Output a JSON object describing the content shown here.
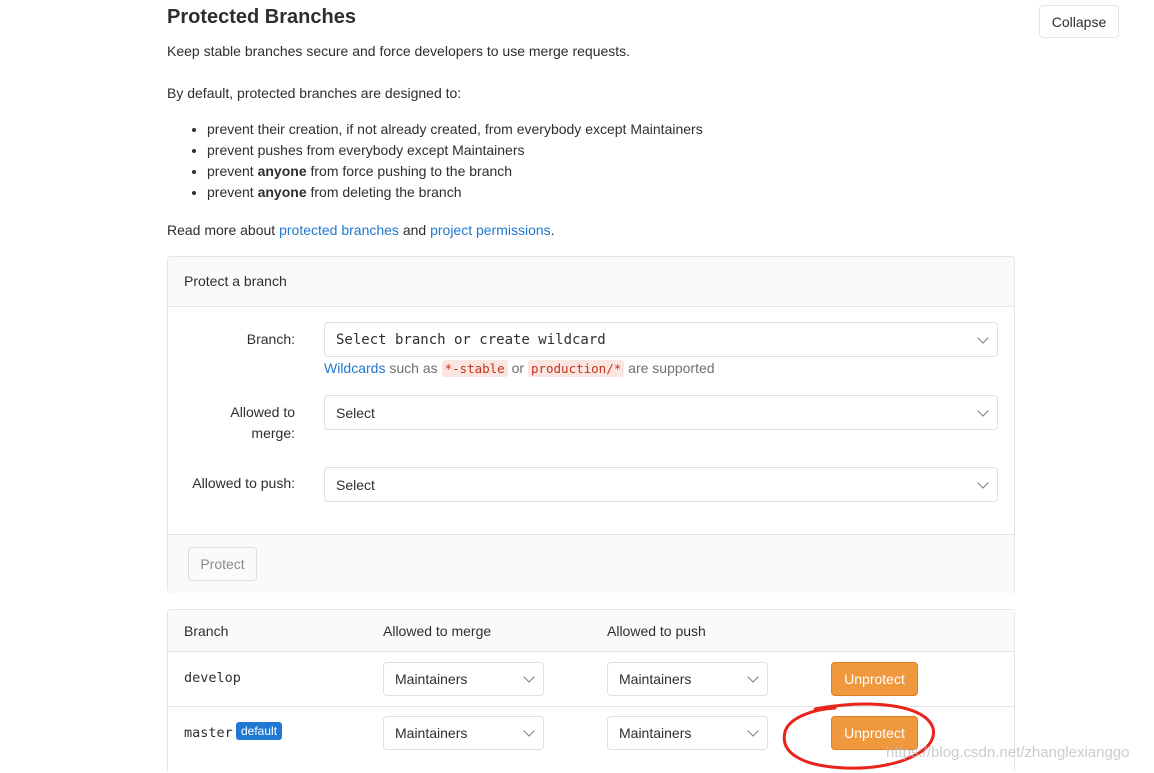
{
  "header": {
    "title": "Protected Branches",
    "collapse_label": "Collapse",
    "description": "Keep stable branches secure and force developers to use merge requests."
  },
  "intro": {
    "default_text": "By default, protected branches are designed to:",
    "bullets": [
      {
        "pre": "prevent their creation, if not already created, from everybody except Maintainers",
        "bold": "",
        "post": ""
      },
      {
        "pre": "prevent pushes from everybody except Maintainers",
        "bold": "",
        "post": ""
      },
      {
        "pre": "prevent ",
        "bold": "anyone",
        "post": " from force pushing to the branch"
      },
      {
        "pre": "prevent ",
        "bold": "anyone",
        "post": " from deleting the branch"
      }
    ],
    "read_more_prefix": "Read more about ",
    "link_protected_branches": "protected branches",
    "and_text": " and ",
    "link_project_permissions": "project permissions",
    "period": "."
  },
  "protect_form": {
    "heading": "Protect a branch",
    "branch_label": "Branch:",
    "branch_placeholder": "Select branch or create wildcard",
    "wildcards_link": "Wildcards",
    "such_as": " such as ",
    "example1": "*-stable",
    "or_text": " or ",
    "example2": "production/*",
    "supported": " are supported",
    "merge_label": "Allowed to merge:",
    "merge_value": "Select",
    "push_label": "Allowed to push:",
    "push_value": "Select",
    "protect_button": "Protect"
  },
  "table": {
    "headers": {
      "branch": "Branch",
      "merge": "Allowed to merge",
      "push": "Allowed to push"
    },
    "rows": [
      {
        "branch": "develop",
        "badge": "",
        "merge": "Maintainers",
        "push": "Maintainers",
        "action": "Unprotect"
      },
      {
        "branch": "master",
        "badge": "default",
        "merge": "Maintainers",
        "push": "Maintainers",
        "action": "Unprotect"
      }
    ]
  },
  "watermark": "https://blog.csdn.net/zhanglexianggo",
  "colors": {
    "link": "#1f78d1",
    "unprotect": "#f0983e",
    "annotation": "#e8241c"
  }
}
